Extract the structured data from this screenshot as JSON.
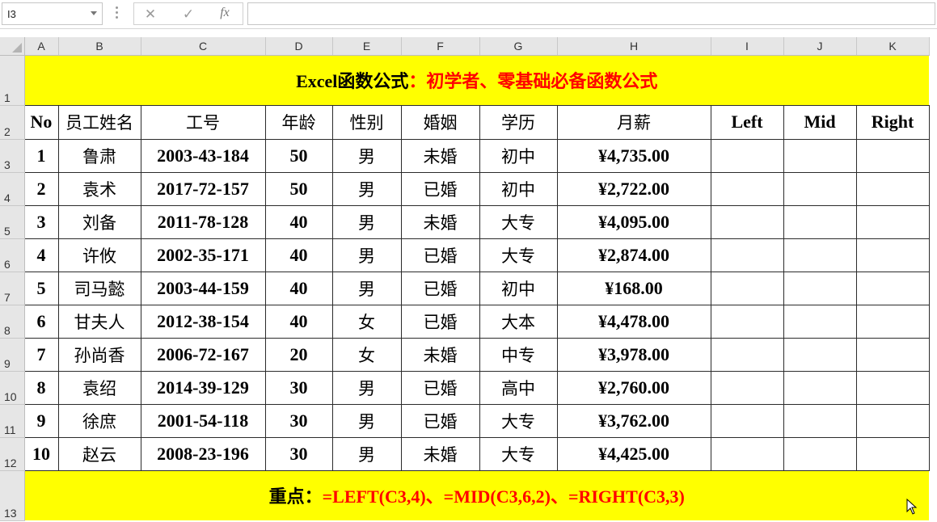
{
  "name_box": "I3",
  "formula_bar": {
    "cancel_icon": "✕",
    "enter_icon": "✓",
    "fx_label": "fx",
    "formula": ""
  },
  "columns": [
    "A",
    "B",
    "C",
    "D",
    "E",
    "F",
    "G",
    "H",
    "I",
    "J",
    "K"
  ],
  "rows": [
    "1",
    "2",
    "3",
    "4",
    "5",
    "6",
    "7",
    "8",
    "9",
    "10",
    "11",
    "12",
    "13"
  ],
  "title": {
    "black": "Excel函数公式",
    "red": "：初学者、零基础必备函数公式"
  },
  "headers": [
    "No",
    "员工姓名",
    "工号",
    "年龄",
    "性别",
    "婚姻",
    "学历",
    "月薪",
    "Left",
    "Mid",
    "Right"
  ],
  "records": [
    [
      "1",
      "鲁肃",
      "2003-43-184",
      "50",
      "男",
      "未婚",
      "初中",
      "¥4,735.00"
    ],
    [
      "2",
      "袁术",
      "2017-72-157",
      "50",
      "男",
      "已婚",
      "初中",
      "¥2,722.00"
    ],
    [
      "3",
      "刘备",
      "2011-78-128",
      "40",
      "男",
      "未婚",
      "大专",
      "¥4,095.00"
    ],
    [
      "4",
      "许攸",
      "2002-35-171",
      "40",
      "男",
      "已婚",
      "大专",
      "¥2,874.00"
    ],
    [
      "5",
      "司马懿",
      "2003-44-159",
      "40",
      "男",
      "已婚",
      "初中",
      "¥168.00"
    ],
    [
      "6",
      "甘夫人",
      "2012-38-154",
      "40",
      "女",
      "已婚",
      "大本",
      "¥4,478.00"
    ],
    [
      "7",
      "孙尚香",
      "2006-72-167",
      "20",
      "女",
      "未婚",
      "中专",
      "¥3,978.00"
    ],
    [
      "8",
      "袁绍",
      "2014-39-129",
      "30",
      "男",
      "已婚",
      "高中",
      "¥2,760.00"
    ],
    [
      "9",
      "徐庶",
      "2001-54-118",
      "30",
      "男",
      "已婚",
      "大专",
      "¥3,762.00"
    ],
    [
      "10",
      "赵云",
      "2008-23-196",
      "30",
      "男",
      "未婚",
      "大专",
      "¥4,425.00"
    ]
  ],
  "footer": {
    "label": "重点：",
    "formula": "=LEFT(C3,4)、=MID(C3,6,2)、=RIGHT(C3,3)"
  },
  "colors": {
    "banner": "#ffff00",
    "accent_text": "#ff0000"
  }
}
